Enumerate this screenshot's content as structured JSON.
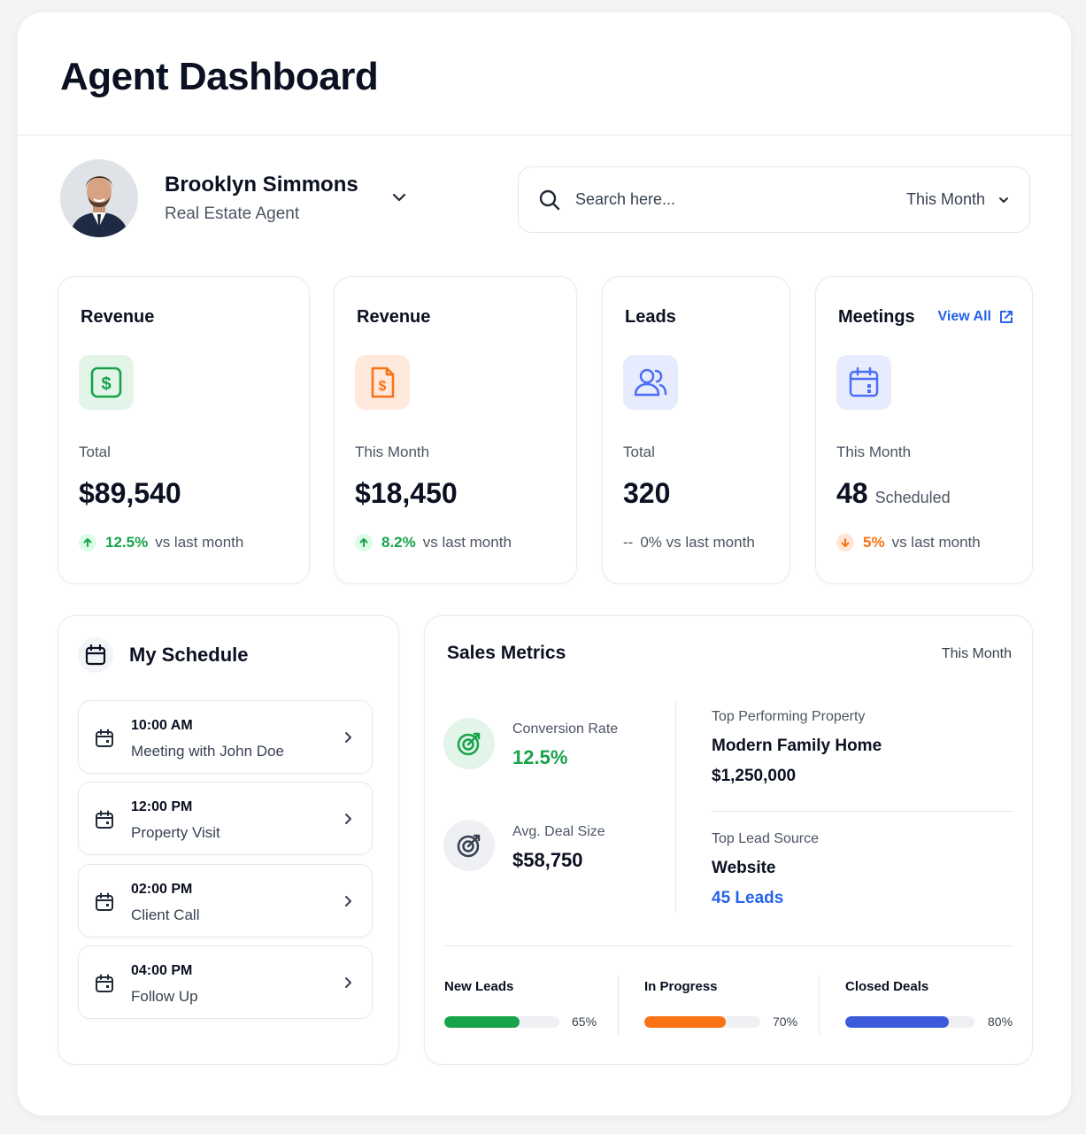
{
  "header": {
    "title": "Agent Dashboard"
  },
  "profile": {
    "name": "Brooklyn Simmons",
    "role": "Real Estate Agent"
  },
  "search": {
    "placeholder": "Search here...",
    "period": "This Month"
  },
  "stats": [
    {
      "title": "Revenue",
      "icon": "dollar-icon",
      "label": "Total",
      "value": "$89,540",
      "trend_dir": "up",
      "trend_pct": "12.5%",
      "trend_text": "vs last month",
      "color": "#16a34a"
    },
    {
      "title": "Revenue",
      "icon": "dollar-document-icon",
      "label": "This Month",
      "value": "$18,450",
      "trend_dir": "up",
      "trend_pct": "8.2%",
      "trend_text": "vs last month",
      "color": "#f97316"
    },
    {
      "title": "Leads",
      "icon": "users-icon",
      "label": "Total",
      "value": "320",
      "trend_dir": "flat",
      "trend_pct": "--",
      "trend_text": "0% vs last month",
      "color": "#4f6ef7"
    },
    {
      "title": "Meetings",
      "icon": "calendar-icon",
      "label": "This Month",
      "value": "48",
      "value_suffix": "Scheduled",
      "trend_dir": "down",
      "trend_pct": "5%",
      "trend_text": "vs last month",
      "color": "#4f6ef7",
      "link": "View All"
    }
  ],
  "schedule": {
    "title": "My Schedule",
    "items": [
      {
        "time": "10:00 AM",
        "label": "Meeting with John Doe"
      },
      {
        "time": "12:00 PM",
        "label": "Property Visit"
      },
      {
        "time": "02:00 PM",
        "label": "Client Call"
      },
      {
        "time": "04:00 PM",
        "label": "Follow Up"
      }
    ]
  },
  "sales": {
    "title": "Sales Metrics",
    "period": "This Month",
    "conversion": {
      "label": "Conversion Rate",
      "value": "12.5%"
    },
    "deal": {
      "label": "Avg. Deal Size",
      "value": "$58,750"
    },
    "top_property": {
      "label": "Top Performing Property",
      "name": "Modern Family Home",
      "price": "$1,250,000"
    },
    "top_source": {
      "label": "Top Lead Source",
      "name": "Website",
      "count": "45 Leads"
    },
    "progress": [
      {
        "label": "New Leads",
        "percent": 65,
        "percent_label": "65%",
        "color": "#16a34a"
      },
      {
        "label": "In Progress",
        "percent": 70,
        "percent_label": "70%",
        "color": "#f97316"
      },
      {
        "label": "Closed Deals",
        "percent": 80,
        "percent_label": "80%",
        "color": "#3b5bdb"
      }
    ]
  },
  "colors": {
    "green": "#16a34a",
    "orange": "#f97316",
    "blue": "#2563eb",
    "dark": "#0b1022"
  }
}
